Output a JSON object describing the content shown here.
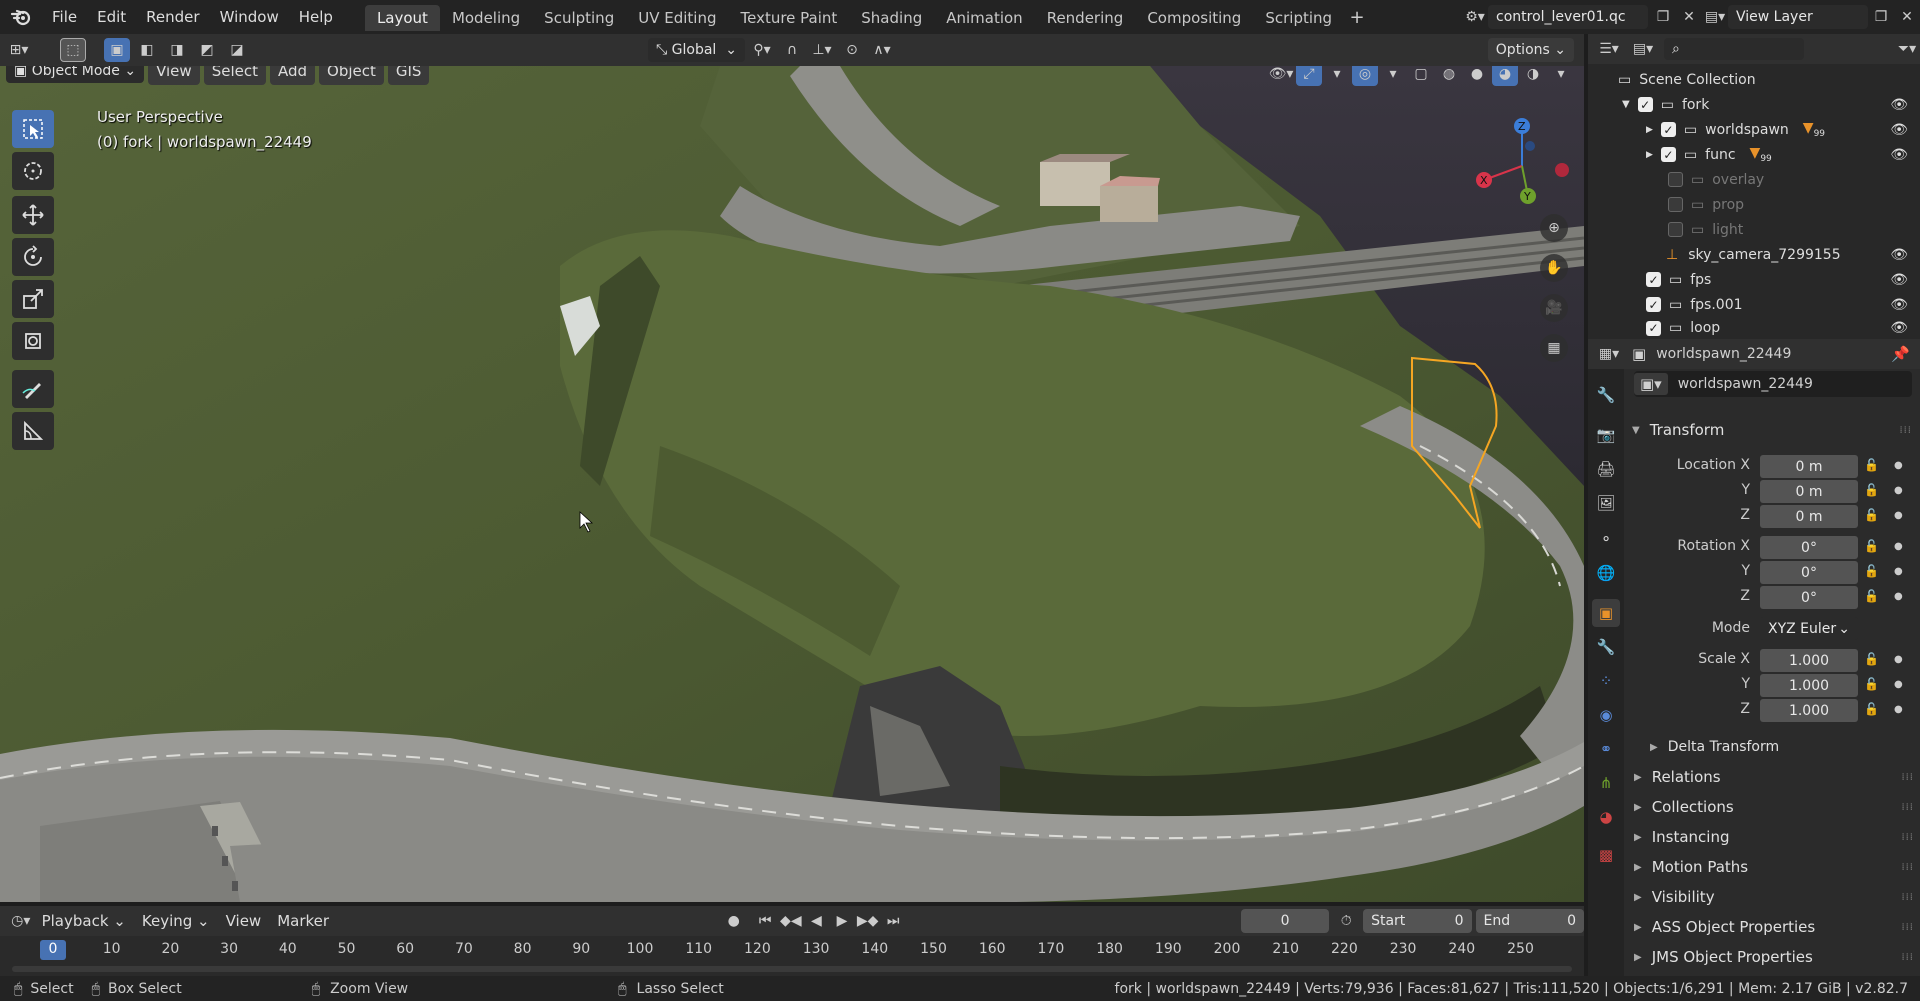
{
  "menus": [
    "File",
    "Edit",
    "Render",
    "Window",
    "Help"
  ],
  "workspaces": [
    "Layout",
    "Modeling",
    "Sculpting",
    "UV Editing",
    "Texture Paint",
    "Shading",
    "Animation",
    "Rendering",
    "Compositing",
    "Scripting"
  ],
  "active_workspace": "Layout",
  "scene_name": "control_lever01.qc",
  "view_layer": "View Layer",
  "viewport": {
    "mode": "Object Mode",
    "menu": [
      "View",
      "Select",
      "Add",
      "Object",
      "GIS"
    ],
    "orientation": "Global",
    "options_label": "Options",
    "perspective_label": "User Perspective",
    "context_label": "(0) fork | worldspawn_22449"
  },
  "outliner": {
    "title": "Scene Collection",
    "rows": [
      {
        "name": "fork",
        "checked": true,
        "visible": true
      },
      {
        "name": "worldspawn",
        "checked": true,
        "visible": true,
        "badge": "99"
      },
      {
        "name": "func",
        "checked": true,
        "visible": true,
        "badge": "99"
      },
      {
        "name": "overlay",
        "checked": false,
        "visible": false
      },
      {
        "name": "prop",
        "checked": false,
        "visible": false
      },
      {
        "name": "light",
        "checked": false,
        "visible": false
      },
      {
        "name": "sky_camera_7299155",
        "visible": true
      },
      {
        "name": "fps",
        "checked": true,
        "visible": true
      },
      {
        "name": "fps.001",
        "checked": true,
        "visible": true
      },
      {
        "name": "loop",
        "checked": true,
        "visible": true
      }
    ]
  },
  "properties": {
    "object_name": "worldspawn_22449",
    "object_field": "worldspawn_22449",
    "transform_label": "Transform",
    "location_x_label": "Location X",
    "rotation_x_label": "Rotation X",
    "scale_x_label": "Scale X",
    "y_label": "Y",
    "z_label": "Z",
    "mode_label": "Mode",
    "location": [
      "0 m",
      "0 m",
      "0 m"
    ],
    "rotation": [
      "0°",
      "0°",
      "0°"
    ],
    "rotation_mode": "XYZ Euler",
    "scale": [
      "1.000",
      "1.000",
      "1.000"
    ],
    "delta_transform": "Delta Transform",
    "panels": [
      "Relations",
      "Collections",
      "Instancing",
      "Motion Paths",
      "Visibility",
      "ASS Object Properties",
      "JMS Object Properties"
    ]
  },
  "timeline": {
    "menus": [
      "Playback",
      "Keying",
      "View",
      "Marker"
    ],
    "current_frame": "0",
    "start_label": "Start",
    "start": "0",
    "end_label": "End",
    "end": "0",
    "ticks": [
      "0",
      "10",
      "20",
      "30",
      "40",
      "50",
      "60",
      "70",
      "80",
      "90",
      "100",
      "110",
      "120",
      "130",
      "140",
      "150",
      "160",
      "170",
      "180",
      "190",
      "200",
      "210",
      "220",
      "230",
      "240",
      "250"
    ]
  },
  "statusbar": {
    "select": "Select",
    "box_select": "Box Select",
    "zoom_view": "Zoom View",
    "lasso_select": "Lasso Select",
    "stats": "fork | worldspawn_22449 | Verts:79,936 | Faces:81,627 | Tris:111,520 | Objects:1/6,291 | Mem: 2.17 GiB | v2.82.7"
  },
  "colors": {
    "accent": "#4772b3",
    "selection": "#f5a623",
    "header": "#303030"
  }
}
